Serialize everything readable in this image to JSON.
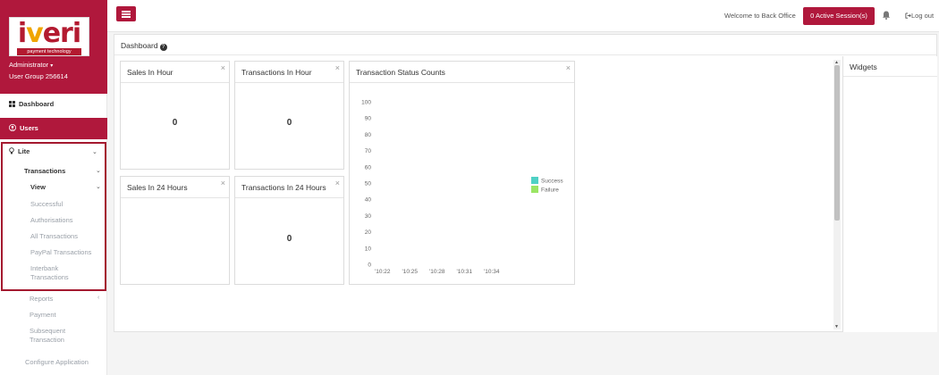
{
  "sidebar": {
    "logo": {
      "brand_main": "iveri",
      "tagline": "payment technology"
    },
    "admin_label": "Administrator",
    "user_group": "User Group 256614",
    "dashboard_label": "Dashboard",
    "users_label": "Users",
    "lite_label": "Lite",
    "transactions_label": "Transactions",
    "view_label": "View",
    "view_items": [
      "Successful",
      "Authorisations",
      "All Transactions",
      "PayPal Transactions",
      "Interbank Transactions"
    ],
    "reports_label": "Reports",
    "payment_label": "Payment",
    "subsequent_label": "Subsequent Transaction",
    "configure_label": "Configure Application"
  },
  "topbar": {
    "welcome": "Welcome to Back Office",
    "active_sessions": "0 Active Session(s)",
    "logout": "Log out"
  },
  "main": {
    "title": "Dashboard",
    "panels": {
      "sales_hour": {
        "title": "Sales In Hour",
        "value": "0"
      },
      "tx_hour": {
        "title": "Transactions In Hour",
        "value": "0"
      },
      "sales_24": {
        "title": "Sales In 24 Hours",
        "value": ""
      },
      "tx_24": {
        "title": "Transactions In 24 Hours",
        "value": "0"
      },
      "status": {
        "title": "Transaction Status Counts"
      }
    },
    "widgets_title": "Widgets",
    "close_glyph": "×"
  },
  "colors": {
    "brand": "#b0183c",
    "success": "#4fd1c5",
    "failure": "#9be564"
  },
  "chart_data": {
    "type": "line",
    "x": [
      "'10:22",
      "'10:25",
      "'10:28",
      "'10:31",
      "'10:34"
    ],
    "yticks": [
      0,
      10,
      20,
      30,
      40,
      50,
      60,
      70,
      80,
      90,
      100
    ],
    "ylim": [
      0,
      100
    ],
    "grid": false,
    "legend": "right",
    "series": [
      {
        "name": "Success",
        "color": "#4fd1c5",
        "values": []
      },
      {
        "name": "Failure",
        "color": "#9be564",
        "values": []
      }
    ]
  }
}
